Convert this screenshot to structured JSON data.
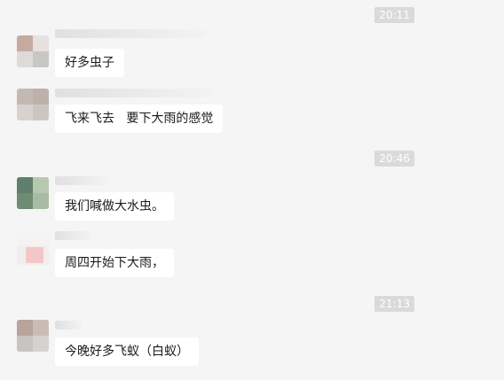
{
  "chat": {
    "timestamps": [
      "20:11",
      "20:46",
      "21:13"
    ],
    "messages": [
      {
        "text": "好多虫子"
      },
      {
        "text": "飞来飞去   要下大雨的感觉"
      },
      {
        "text": "我们喊做大水虫。"
      },
      {
        "text": "周四开始下大雨，"
      },
      {
        "text": "今晚好多飞蚁（白蚁）"
      }
    ]
  }
}
